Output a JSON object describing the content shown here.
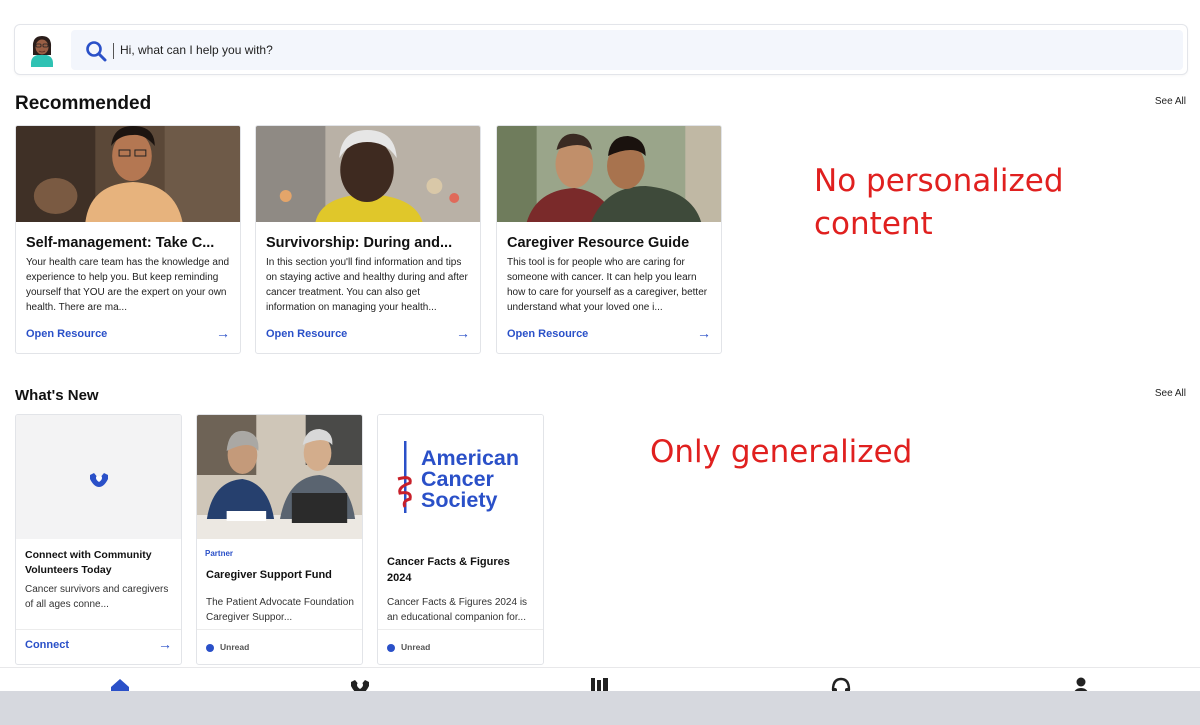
{
  "search": {
    "placeholder": "Hi, what can I help you with?"
  },
  "recommended": {
    "title": "Recommended",
    "see_all": "See All",
    "cards": [
      {
        "title": "Self-management: Take C...",
        "description": "Your health care team has the knowledge and experience to help you. But keep reminding yourself that YOU are the expert on your own health. There are ma...",
        "link": "Open Resource",
        "arrow": "→"
      },
      {
        "title": "Survivorship: During and...",
        "description": "In this section you'll find information and tips on staying active and healthy during and after cancer treatment. You can also get information on managing your health...",
        "link": "Open Resource",
        "arrow": "→"
      },
      {
        "title": "Caregiver Resource Guide",
        "description": "This tool is for people who are caring for someone with cancer. It can help you learn how to care for yourself as a caregiver, better understand what your loved one i...",
        "link": "Open Resource",
        "arrow": "→"
      }
    ]
  },
  "whats_new": {
    "title": "What's New",
    "see_all": "See All",
    "cards": [
      {
        "title": "Connect with Community Volunteers Today",
        "description": "Cancer survivors and caregivers of all ages conne...",
        "link": "Connect",
        "arrow": "→"
      },
      {
        "tag": "Partner",
        "title": "Caregiver Support Fund",
        "description": "The Patient Advocate Foundation Caregiver Suppor...",
        "status": "Unread"
      },
      {
        "logo_text": [
          "American",
          "Cancer",
          "Society"
        ],
        "title": "Cancer Facts & Figures 2024",
        "description": "Cancer Facts & Figures 2024 is an educational companion for...",
        "status": "Unread"
      }
    ]
  },
  "annotations": {
    "first_line1": "No personalized",
    "first_line2": "content",
    "second": "Only generalized"
  },
  "nav": {
    "items": [
      "home-icon",
      "community-icon",
      "library-icon",
      "support-headset-icon",
      "profile-icon"
    ]
  },
  "colors": {
    "accent": "#2a50c8",
    "annotation": "#e0201f",
    "search_bg": "#f3f6fc",
    "bottom_strip": "#d6d8de"
  }
}
